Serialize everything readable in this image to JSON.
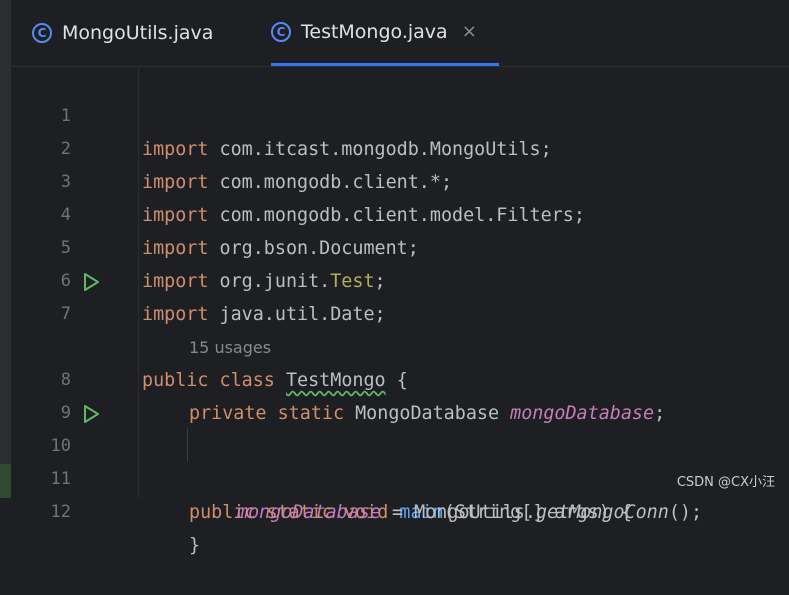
{
  "tabs": [
    {
      "label": "MongoUtils.java",
      "icon": "C",
      "active": false
    },
    {
      "label": "TestMongo.java",
      "icon": "C",
      "active": true,
      "close": "×"
    }
  ],
  "editor": {
    "line_numbers": [
      "1",
      "2",
      "3",
      "4",
      "5",
      "6",
      "7",
      "8",
      "9",
      "10",
      "11",
      "12"
    ],
    "lines": [
      {
        "kw": "import",
        "rest": " com.itcast.mongodb.MongoUtils;"
      },
      {
        "kw": "import",
        "rest": " com.mongodb.client.*;"
      },
      {
        "kw": "import",
        "rest": " com.mongodb.client.model.Filters;"
      },
      {
        "kw": "import",
        "rest": " org.bson.Document;"
      },
      {
        "kw": "import",
        "rest": " org.junit.",
        "ann": "Test",
        "tail": ";"
      },
      {
        "kw": "import",
        "rest": " java.util.Date;"
      },
      {
        "kw1": "public",
        "kw2": "class",
        "name": "TestMongo",
        "tail": " {"
      },
      {
        "kw1": "private",
        "kw2": "static",
        "type": " MongoDatabase ",
        "field": "mongoDatabase",
        "tail": ";"
      },
      {},
      {
        "kw1": "public",
        "kw2": "static",
        "kw3": "void",
        "fn": "main",
        "tail": "(String[] args) {"
      },
      {
        "field": "mongoDatabase",
        "mid": " = MongoUtils.",
        "call": "getMongoConn",
        "tail": "();"
      },
      {
        "tail": "}"
      }
    ],
    "usage_hint": "15 usages"
  },
  "watermark": "CSDN @CX小汪",
  "colors": {
    "keyword": "#cf8e6d",
    "annotation": "#b3ae60",
    "function": "#56a8f5",
    "field": "#c77dbb",
    "run_icon": "#5fb865",
    "accent": "#3574f0"
  }
}
